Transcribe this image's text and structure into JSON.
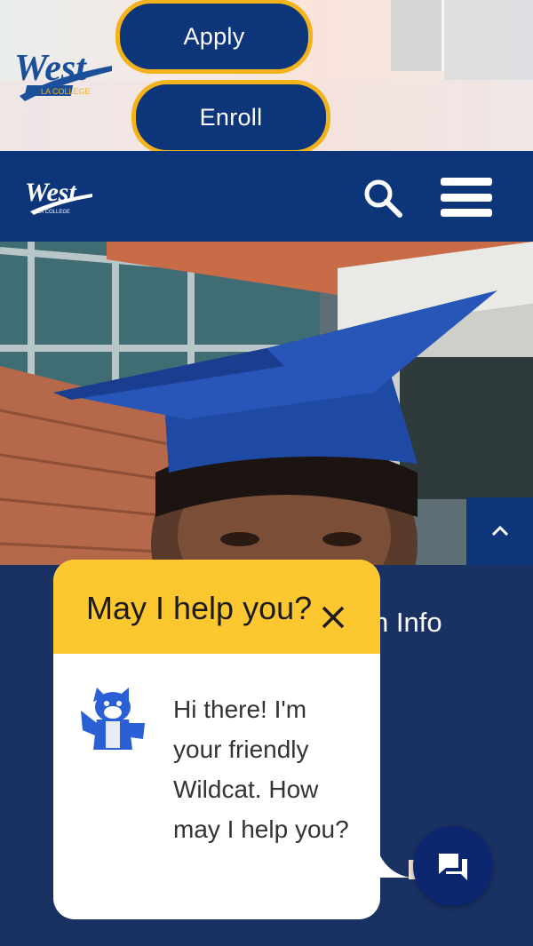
{
  "header": {
    "apply_label": "Apply",
    "enroll_label": "Enroll",
    "logo_text": "West",
    "logo_subtext": "LA COLLEGE"
  },
  "nav": {
    "logo_text": "West",
    "logo_subtext": "LA COLLEGE",
    "search_icon": "search-icon",
    "menu_icon": "hamburger-menu-icon"
  },
  "hero": {
    "image_desc": "graduate-cap-photo"
  },
  "section": {
    "heading_partial": "n Info",
    "scroll_top_icon": "chevron-up-icon"
  },
  "chat": {
    "title": "May I help you?",
    "message": "Hi there! I'm your friendly Wildcat. How may I help you?",
    "close_icon": "close-icon",
    "fab_icon": "chat-bubbles-icon"
  },
  "colors": {
    "navy": "#0d3579",
    "gold": "#f2b31b",
    "chat_header": "#fdc72f",
    "section_bg": "#1a3263"
  }
}
